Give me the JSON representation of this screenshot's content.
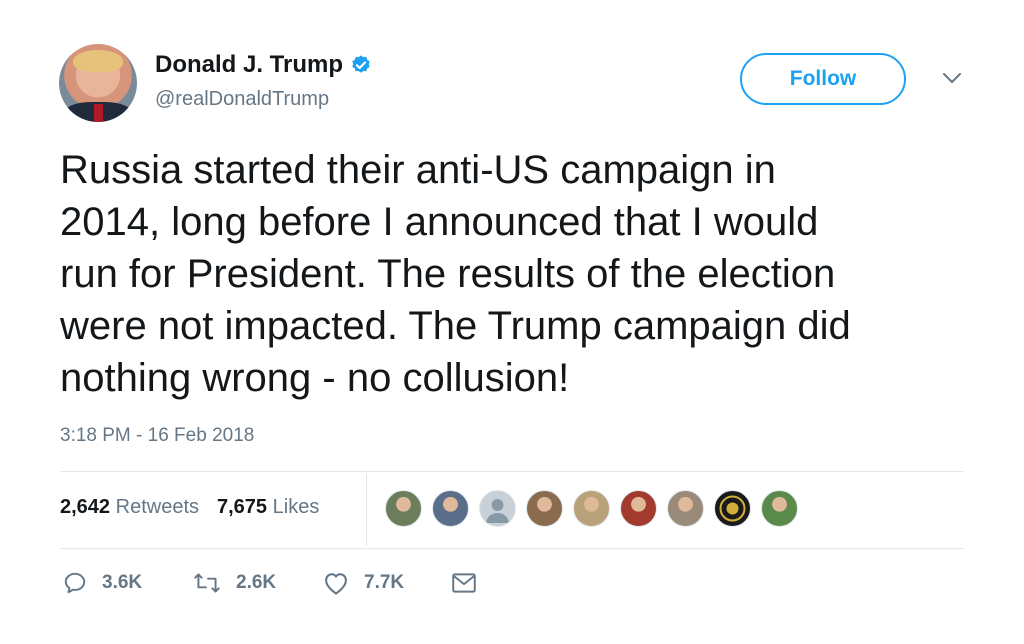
{
  "user": {
    "name": "Donald J. Trump",
    "handle": "@realDonaldTrump",
    "verified_color": "#1da1f2"
  },
  "follow_label": "Follow",
  "tweet": {
    "text": "Russia started their anti-US campaign in\n2014, long before I announced that I would\nrun for President. The results of the election\nwere not impacted. The Trump campaign did\nnothing wrong - no collusion!",
    "timestamp": "3:18 PM - 16 Feb 2018"
  },
  "stats": {
    "retweets_count": "2,642",
    "retweets_label": "Retweets",
    "likes_count": "7,675",
    "likes_label": "Likes"
  },
  "likers": [
    {
      "icon": "liker-avatar",
      "color": "#6b7d5a"
    },
    {
      "icon": "liker-avatar",
      "color": "#5a6e8a"
    },
    {
      "icon": "default-avatar",
      "color": "#c8d0d8"
    },
    {
      "icon": "liker-avatar",
      "color": "#8a6b4e"
    },
    {
      "icon": "liker-avatar",
      "color": "#b8a27a"
    },
    {
      "icon": "liker-avatar",
      "color": "#a23a2e"
    },
    {
      "icon": "liker-avatar",
      "color": "#9a8a7a"
    },
    {
      "icon": "badge-avatar",
      "color": "#1a1a1a"
    },
    {
      "icon": "liker-avatar",
      "color": "#5a8a4a"
    }
  ],
  "actions": {
    "reply": "3.6K",
    "retweet": "2.6K",
    "like": "7.7K"
  },
  "colors": {
    "accent": "#1da1f2",
    "text": "#14171a",
    "secondary": "#657786",
    "border": "#e1e8ed"
  }
}
